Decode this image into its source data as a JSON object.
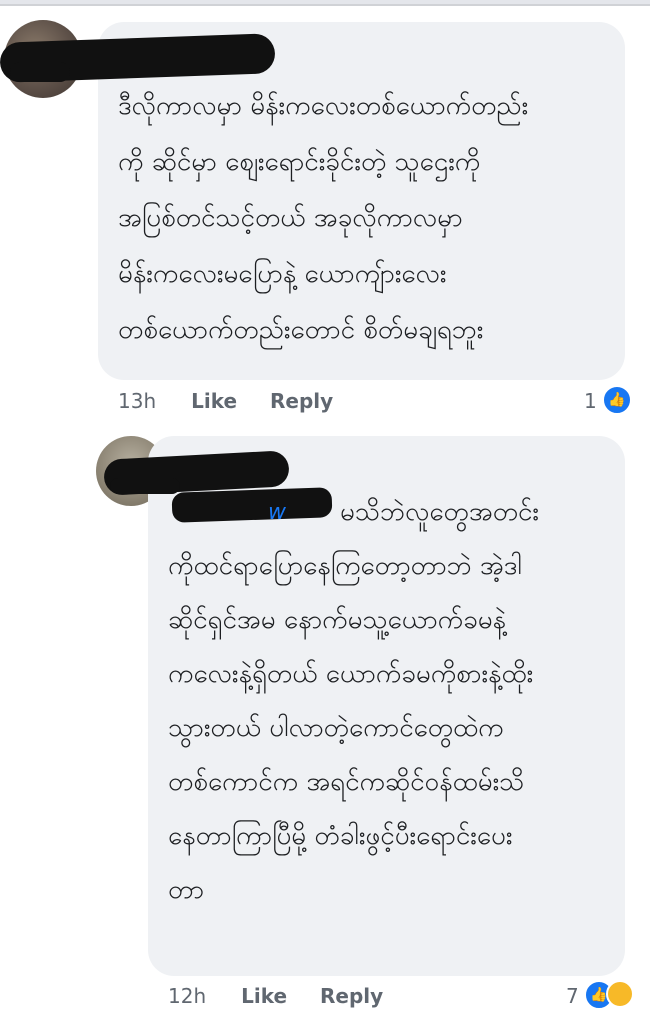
{
  "comment1": {
    "lines": [
      "ဒီလိုကာလမှာ မိန်းကလေးတစ်ယောက်တည်း",
      "ကို ဆိုင်မှာ စျေးရောင်းခိုင်းတဲ့ သူဌေးကို",
      "အပြစ်တင်သင့်တယ် အခုလိုကာလမှာ",
      "မိန်းကလေးမပြောနဲ့ ယောကျ်ားလေး",
      "တစ်ယောက်တည်းတောင် စိတ်မချရဘူး"
    ],
    "time": "13h",
    "like_label": "Like",
    "reply_label": "Reply",
    "reaction_count": "1",
    "reaction_icon": "thumbs-up-icon"
  },
  "comment2": {
    "mention_tail": "w",
    "lines": [
      "မသိဘဲလူတွေအတင်း",
      "ကိုထင်ရာပြောနေကြတော့တာဘဲ အဲ့ဒါ",
      "ဆိုင်ရှင်အမ နောက်မသူ့ယောက်ခမနဲ့",
      "ကလေးနဲ့ရှိတယ် ယောက်ခမကိုစားနဲ့ထိုး",
      "သွားတယ် ပါလာတဲ့ကောင်တွေထဲက",
      "တစ်ကောင်က အရင်ကဆိုင်ဝန်ထမ်းသိ",
      "နေတာကြာပြီမို့ တံခါးဖွင့်ပီးရောင်းပေး",
      "တာ"
    ],
    "time": "12h",
    "like_label": "Like",
    "reply_label": "Reply",
    "reaction_count": "7",
    "reaction_icons": [
      "thumbs-up-icon",
      "haha-icon"
    ]
  },
  "colors": {
    "bubble": "#eff1f4",
    "text": "#1c1e21",
    "meta": "#606770",
    "like_blue": "#1877f2"
  }
}
